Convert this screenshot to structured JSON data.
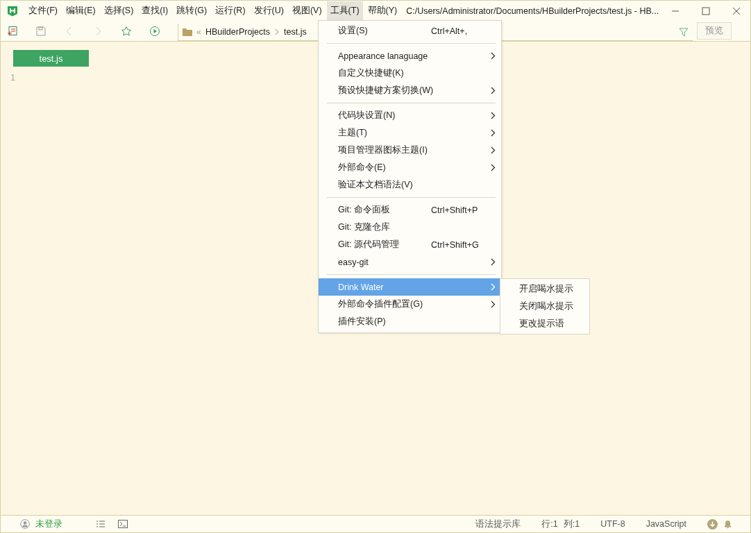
{
  "menubar": [
    {
      "label": "文件(F)",
      "selected": false
    },
    {
      "label": "编辑(E)",
      "selected": false
    },
    {
      "label": "选择(S)",
      "selected": false
    },
    {
      "label": "查找(I)",
      "selected": false
    },
    {
      "label": "跳转(G)",
      "selected": false
    },
    {
      "label": "运行(R)",
      "selected": false
    },
    {
      "label": "发行(U)",
      "selected": false
    },
    {
      "label": "视图(V)",
      "selected": false
    },
    {
      "label": "工具(T)",
      "selected": true
    },
    {
      "label": "帮助(Y)",
      "selected": false
    }
  ],
  "window": {
    "title": "C:/Users/Administrator/Documents/HBuilderProjects/test.js - HB..."
  },
  "breadcrumb": {
    "sep": "«",
    "folder": "HBuilderProjects",
    "file": "test.js"
  },
  "preview_button": "预览",
  "editor": {
    "tab": "test.js",
    "line_numbers": [
      "1"
    ]
  },
  "tools_menu": [
    [
      {
        "label": "设置(S)",
        "shortcut": "Ctrl+Alt+,",
        "kind": "plain",
        "selected": false
      }
    ],
    [
      {
        "label": "Appearance lanaguage",
        "kind": "submenu",
        "selected": false
      },
      {
        "label": "自定义快捷键(K)",
        "kind": "plain",
        "selected": false
      },
      {
        "label": "预设快捷键方案切换(W)",
        "kind": "submenu",
        "selected": false
      }
    ],
    [
      {
        "label": "代码块设置(N)",
        "kind": "submenu",
        "selected": false
      },
      {
        "label": "主题(T)",
        "kind": "submenu",
        "selected": false
      },
      {
        "label": "项目管理器图标主题(I)",
        "kind": "submenu",
        "selected": false
      },
      {
        "label": "外部命令(E)",
        "kind": "submenu",
        "selected": false
      },
      {
        "label": "验证本文档语法(V)",
        "kind": "plain",
        "selected": false
      }
    ],
    [
      {
        "label": "Git: 命令面板",
        "shortcut": "Ctrl+Shift+P",
        "kind": "plain",
        "selected": false
      },
      {
        "label": "Git: 克隆仓库",
        "kind": "plain",
        "selected": false
      },
      {
        "label": "Git: 源代码管理",
        "shortcut": "Ctrl+Shift+G",
        "kind": "plain",
        "selected": false
      },
      {
        "label": "easy-git",
        "kind": "submenu",
        "selected": false
      }
    ],
    [
      {
        "label": "Drink Water",
        "kind": "submenu",
        "selected": true
      },
      {
        "label": "外部命令插件配置(G)",
        "kind": "submenu",
        "selected": false
      },
      {
        "label": "插件安装(P)",
        "kind": "plain",
        "selected": false
      }
    ]
  ],
  "submenu": [
    "开启喝水提示",
    "关闭喝水提示",
    "更改提示语"
  ],
  "status_bar": {
    "user": "未登录",
    "syntax": "语法提示库",
    "line": "行:1",
    "column": "列:1",
    "encoding": "UTF-8",
    "language": "JavaScript"
  }
}
